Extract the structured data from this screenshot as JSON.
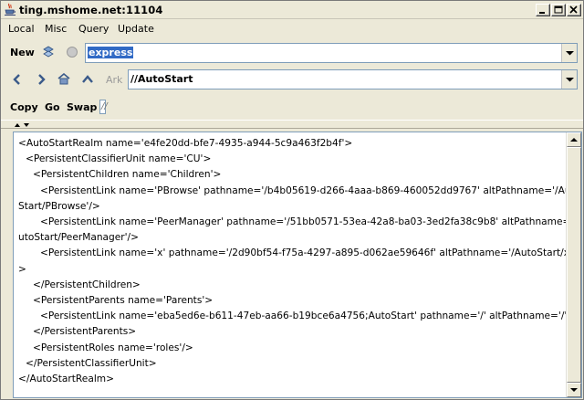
{
  "window": {
    "title": "ting.mshome.net:11104"
  },
  "menu": {
    "local": "Local",
    "misc": "Misc",
    "query": "Query",
    "update": "Update"
  },
  "toolbar1": {
    "new_label": "New",
    "query_value": "express"
  },
  "toolbar2": {
    "ark_label": "Ark",
    "path_value": "//AutoStart"
  },
  "toolbar3": {
    "copy_label": "Copy",
    "go_label": "Go",
    "swap_label": "Swap",
    "swap_value": "//"
  },
  "content": {
    "lines": [
      "<AutoStartRealm name='e4fe20dd-bfe7-4935-a944-5c9a463f2b4f'>",
      "<PersistentClassifierUnit name='CU'>",
      "<PersistentChildren name='Children'>",
      "<PersistentLink name='PBrowse' pathname='/b4b05619-d266-4aaa-b869-460052dd9767' altPathname='/Auto",
      "Start/PBrowse'/>",
      "<PersistentLink name='PeerManager' pathname='/51bb0571-53ea-42a8-ba03-3ed2fa38c9b8' altPathname='/A",
      "utoStart/PeerManager'/>",
      "<PersistentLink name='x' pathname='/2d90bf54-f75a-4297-a895-d062ae59646f' altPathname='/AutoStart/x'/",
      ">",
      "</PersistentChildren>",
      "<PersistentParents name='Parents'>",
      "<PersistentLink name='eba5ed6e-b611-47eb-aa66-b19bce6a4756;AutoStart' pathname='/' altPathname='/'/>",
      "</PersistentParents>",
      "<PersistentRoles name='roles'/>",
      "</PersistentClassifierUnit>",
      "</AutoStartRealm>"
    ]
  }
}
